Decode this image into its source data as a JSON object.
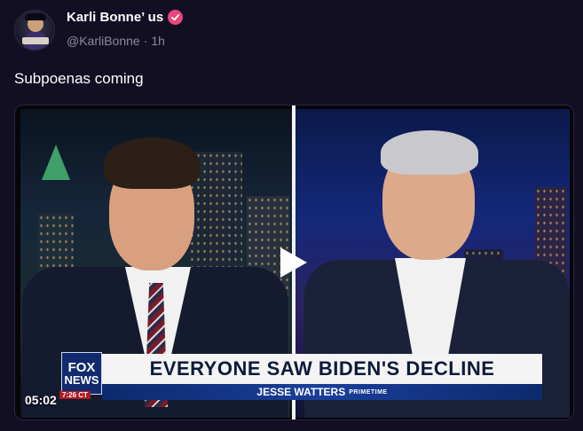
{
  "author": {
    "display_name": "Karli Bonne’ us",
    "handle": "@KarliBonne",
    "separator": "·",
    "time": "1h"
  },
  "post": {
    "text": "Subpoenas coming"
  },
  "video": {
    "timestamp": "05:02",
    "chyron_headline": "EVERYONE SAW BIDEN'S DECLINE",
    "show_name": "JESSE WATTERS",
    "show_brand": "PRIMETIME",
    "network_line1": "FOX",
    "network_line2": "NEWS",
    "channel_clock": "7:26 CT"
  },
  "colors": {
    "background": "#120f24",
    "verified_badge": "#e8467c",
    "chyron_blue": "#0d2a6e"
  },
  "icons": {
    "verified": "check-badge-icon",
    "play": "play-icon"
  }
}
